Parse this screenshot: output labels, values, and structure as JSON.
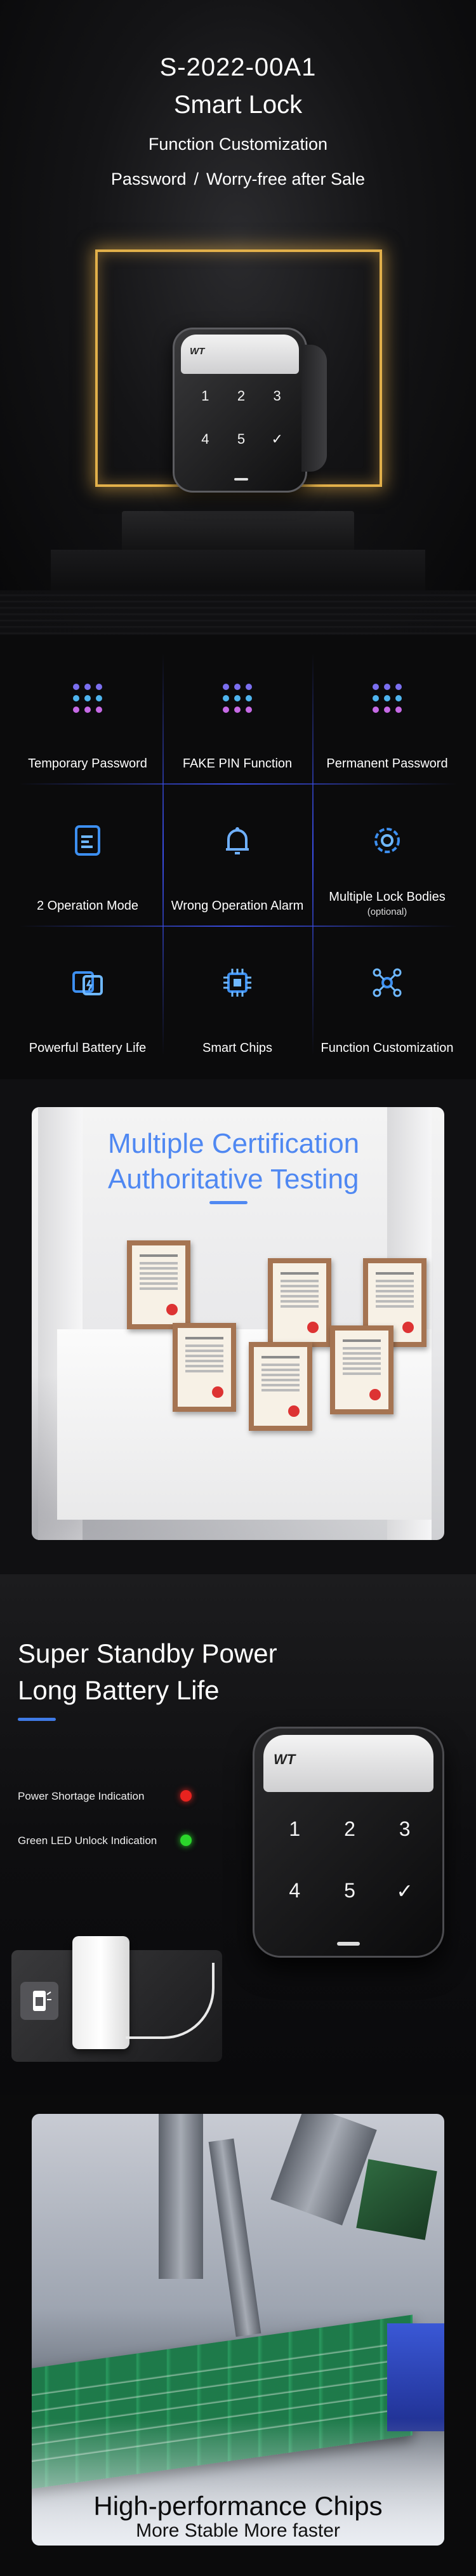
{
  "hero": {
    "model": "S-2022-00A1",
    "product": "Smart Lock",
    "subline": "Function Customization",
    "tagline_left": "Password",
    "tagline_sep": "/",
    "tagline_right": "Worry-free after Sale",
    "accent_frame_color": "#e2b04a"
  },
  "lock": {
    "logo": "WT",
    "keys": [
      "1",
      "2",
      "3",
      "4",
      "5",
      "✓"
    ]
  },
  "features": [
    {
      "label": "Temporary Password",
      "sub": "",
      "icon": "dot-grid-icon"
    },
    {
      "label": "FAKE PIN Function",
      "sub": "",
      "icon": "dot-grid-icon"
    },
    {
      "label": "Permanent Password",
      "sub": "",
      "icon": "dot-grid-icon"
    },
    {
      "label": "2 Operation Mode",
      "sub": "",
      "icon": "document-icon"
    },
    {
      "label": "Wrong Operation Alarm",
      "sub": "",
      "icon": "bell-icon"
    },
    {
      "label": "Multiple Lock Bodies",
      "sub": "(optional)",
      "icon": "gear-icon"
    },
    {
      "label": "Powerful Battery Life",
      "sub": "",
      "icon": "battery-swap-icon"
    },
    {
      "label": "Smart Chips",
      "sub": "",
      "icon": "chip-icon"
    },
    {
      "label": "Function Customization",
      "sub": "",
      "icon": "network-icon"
    }
  ],
  "certification": {
    "line1": "Multiple Certification",
    "line2": "Authoritative Testing",
    "accent_color": "#4f88f2"
  },
  "battery": {
    "line1": "Super Standby Power",
    "line2": "Long Battery Life",
    "indicator_red": "Power Shortage Indication",
    "indicator_green": "Green LED Unlock Indication",
    "red_color": "#e8231f",
    "green_color": "#2bd62b"
  },
  "chips": {
    "title": "High-performance Chips",
    "subtitle": "More Stable More faster"
  }
}
